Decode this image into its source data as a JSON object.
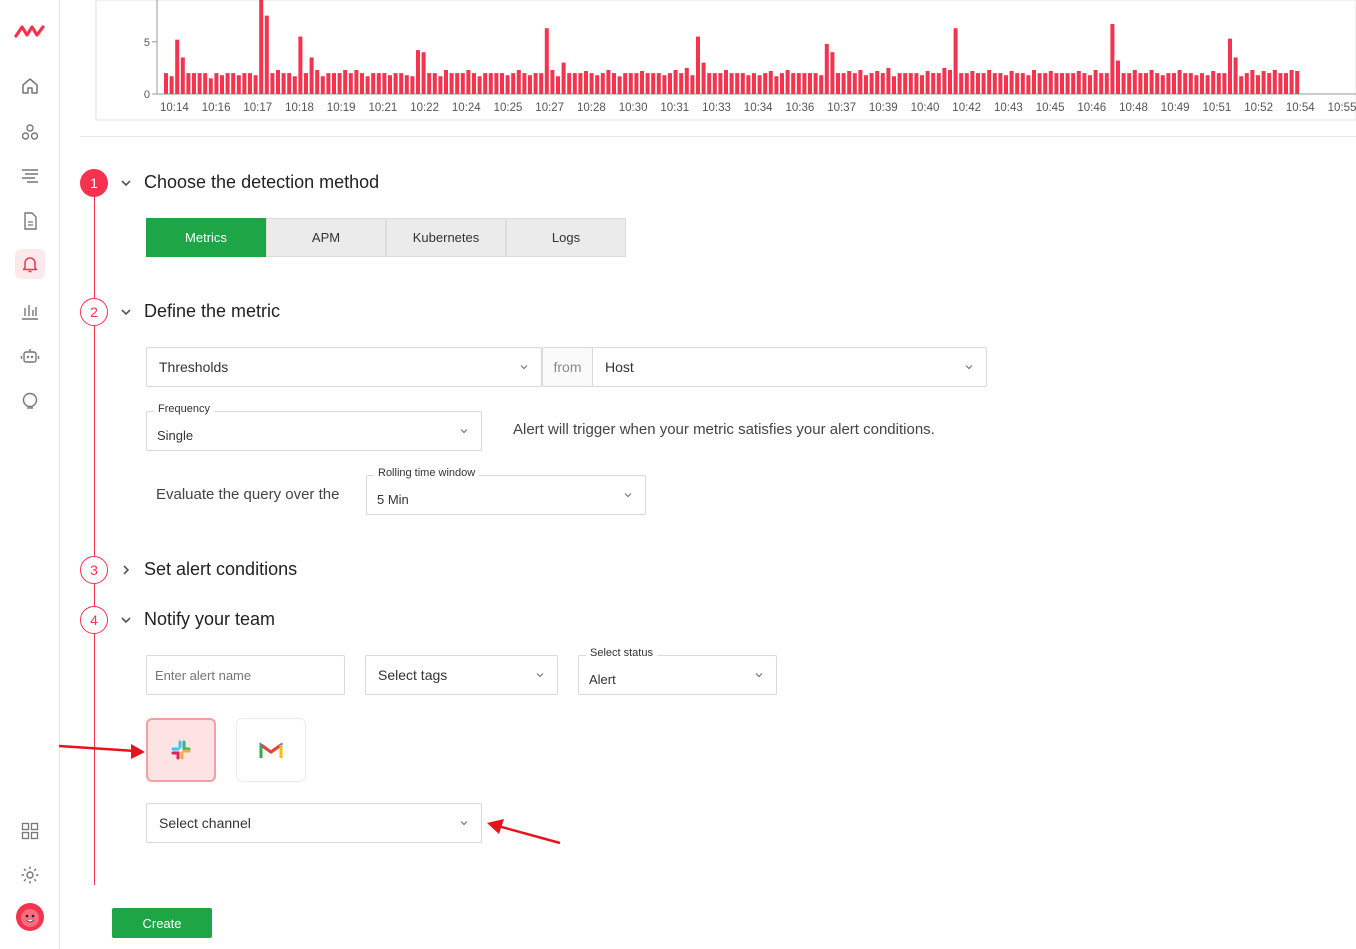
{
  "brand": {
    "accent": "#f5334f",
    "success": "#1da546"
  },
  "sidebar": {
    "items": [
      {
        "icon": "home-icon"
      },
      {
        "icon": "apps-icon"
      },
      {
        "icon": "list-icon"
      },
      {
        "icon": "document-icon"
      },
      {
        "icon": "bell-icon",
        "active": true
      },
      {
        "icon": "bar-chart-icon"
      },
      {
        "icon": "robot-icon"
      },
      {
        "icon": "ai-assistant-icon"
      }
    ],
    "bottom": [
      {
        "icon": "grid-icon"
      },
      {
        "icon": "gear-icon"
      },
      {
        "icon": "avatar"
      }
    ]
  },
  "chart_data": {
    "type": "bar",
    "y_ticks": [
      "0",
      "5"
    ],
    "ylim": [
      0,
      9
    ],
    "x_tick_labels": [
      "10:14",
      "10:16",
      "10:17",
      "10:18",
      "10:19",
      "10:21",
      "10:22",
      "10:24",
      "10:25",
      "10:27",
      "10:28",
      "10:30",
      "10:31",
      "10:33",
      "10:34",
      "10:36",
      "10:37",
      "10:39",
      "10:40",
      "10:42",
      "10:43",
      "10:45",
      "10:46",
      "10:48",
      "10:49",
      "10:51",
      "10:52",
      "10:54",
      "10:55",
      "10:5"
    ],
    "values": [
      2,
      1.7,
      5.2,
      3.5,
      2,
      2,
      2,
      2,
      1.5,
      2,
      1.8,
      2,
      2,
      1.8,
      2,
      2,
      1.8,
      9,
      7.5,
      2,
      2.3,
      2,
      2,
      1.7,
      5.5,
      2,
      3.5,
      2.3,
      1.7,
      2,
      2,
      2,
      2.3,
      2,
      2.3,
      2,
      1.7,
      2,
      2,
      2,
      1.8,
      2,
      2,
      1.8,
      1.7,
      4.2,
      4,
      2,
      2,
      1.7,
      2.3,
      2,
      2,
      2,
      2.3,
      2,
      1.7,
      2,
      2,
      2,
      2,
      1.8,
      2,
      2.3,
      2,
      1.8,
      2,
      2,
      6.3,
      2.3,
      1.7,
      3,
      2,
      2,
      2,
      2.2,
      2,
      1.8,
      2,
      2.3,
      2,
      1.7,
      2,
      2,
      2,
      2.2,
      2,
      2,
      2,
      1.8,
      2,
      2.3,
      2,
      2.5,
      1.8,
      5.5,
      3,
      2,
      2,
      2,
      2.3,
      2,
      2,
      2,
      1.8,
      2,
      1.8,
      2,
      2.2,
      1.7,
      2,
      2.3,
      2,
      2,
      2,
      2,
      2,
      1.8,
      4.8,
      4,
      2,
      2,
      2.2,
      2,
      2.3,
      1.8,
      2,
      2.2,
      2,
      2.5,
      1.7,
      2,
      2,
      2,
      2,
      1.8,
      2.2,
      2,
      2,
      2.5,
      2.3,
      6.3,
      2,
      2,
      2.2,
      2,
      2,
      2.3,
      2,
      2,
      1.8,
      2.2,
      2,
      2,
      1.8,
      2.3,
      2,
      2,
      2.2,
      2,
      2,
      2,
      2,
      2.2,
      2,
      1.8,
      2.3,
      2,
      2,
      6.7,
      3.2,
      2,
      2,
      2.3,
      2,
      2,
      2.3,
      2,
      1.8,
      2,
      2,
      2.3,
      2,
      2,
      1.8,
      2,
      1.8,
      2.2,
      2,
      2,
      5.3,
      3.5,
      1.7,
      2,
      2.3,
      1.8,
      2.2,
      2,
      2.3,
      2,
      2,
      2.3,
      2.2
    ],
    "color": "#f5334f"
  },
  "steps": [
    {
      "number": "1",
      "title": "Choose the detection method",
      "expanded": true
    },
    {
      "number": "2",
      "title": "Define the metric",
      "expanded": true
    },
    {
      "number": "3",
      "title": "Set alert conditions",
      "expanded": false
    },
    {
      "number": "4",
      "title": "Notify your team",
      "expanded": true
    }
  ],
  "detection_tabs": [
    {
      "label": "Metrics",
      "active": true
    },
    {
      "label": "APM",
      "active": false
    },
    {
      "label": "Kubernetes",
      "active": false
    },
    {
      "label": "Logs",
      "active": false
    }
  ],
  "metric": {
    "type_value": "Thresholds",
    "from_label": "from",
    "source_value": "Host",
    "frequency_label": "Frequency",
    "frequency_value": "Single",
    "trigger_note": "Alert will trigger when your metric satisfies your alert conditions.",
    "evaluate_text": "Evaluate the query over the",
    "window_label": "Rolling time window",
    "window_value": "5 Min"
  },
  "notify": {
    "alert_name_placeholder": "Enter alert name",
    "tags_placeholder": "Select tags",
    "status_label": "Select status",
    "status_value": "Alert",
    "channels": [
      {
        "icon": "slack-icon",
        "selected": true
      },
      {
        "icon": "gmail-icon",
        "selected": false
      }
    ],
    "channel_placeholder": "Select channel"
  },
  "create_label": "Create"
}
